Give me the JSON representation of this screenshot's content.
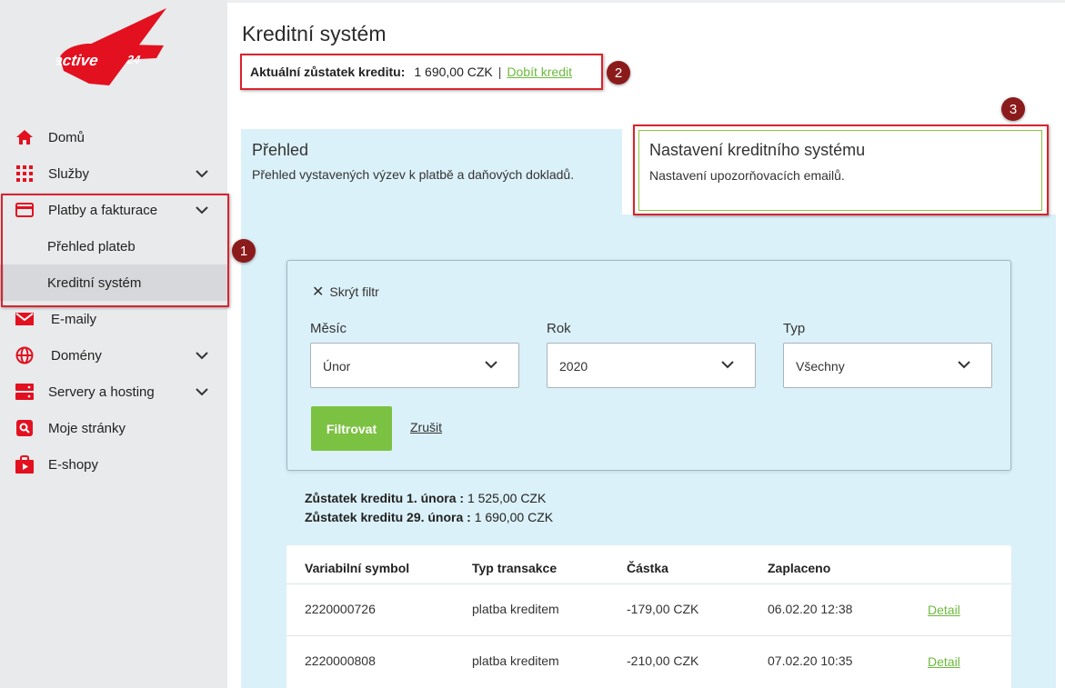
{
  "brand": {
    "logo_text": "active 24",
    "accent": "#e3101f"
  },
  "sidebar": {
    "items": [
      {
        "label": "Domů",
        "icon": "home-icon"
      },
      {
        "label": "Služby",
        "icon": "grid-icon"
      },
      {
        "label": "Platby a fakturace",
        "icon": "credit-card-icon"
      },
      {
        "label": "Přehled plateb"
      },
      {
        "label": "Kreditní systém"
      },
      {
        "label": "E-maily",
        "icon": "mail-icon"
      },
      {
        "label": "Domény",
        "icon": "globe-icon"
      },
      {
        "label": "Servery a hosting",
        "icon": "server-icon"
      },
      {
        "label": "Moje stránky",
        "icon": "search-page-icon"
      },
      {
        "label": "E-shopy",
        "icon": "shop-bag-icon"
      }
    ]
  },
  "annotations": [
    "1",
    "2",
    "3"
  ],
  "page": {
    "title": "Kreditní systém",
    "balance_label": "Aktuální zůstatek kreditu:",
    "balance_value": "1 690,00 CZK",
    "separator": "|",
    "topup_link": "Dobít kredit"
  },
  "tabs": [
    {
      "title": "Přehled",
      "desc": "Přehled vystavených výzev k platbě a daňových dokladů."
    },
    {
      "title": "Nastavení kreditního systému",
      "desc": "Nastavení upozorňovacích emailů."
    }
  ],
  "filter": {
    "hide_label": "Skrýt filtr",
    "month_label": "Měsíc",
    "month_value": "Únor",
    "year_label": "Rok",
    "year_value": "2020",
    "type_label": "Typ",
    "type_value": "Všechny",
    "submit_label": "Filtrovat",
    "cancel_label": "Zrušit"
  },
  "summary": {
    "start_label": "Zůstatek kreditu 1. února :",
    "start_value": "1 525,00 CZK",
    "end_label": "Zůstatek kreditu 29. února :",
    "end_value": "1 690,00 CZK"
  },
  "table": {
    "headers": [
      "Variabilní symbol",
      "Typ transakce",
      "Částka",
      "Zaplaceno"
    ],
    "rows": [
      {
        "symbol": "2220000726",
        "type": "platba kreditem",
        "amount": "-179,00 CZK",
        "paid": "06.02.20 12:38",
        "action": "Detail"
      },
      {
        "symbol": "2220000808",
        "type": "platba kreditem",
        "amount": "-210,00 CZK",
        "paid": "07.02.20 10:35",
        "action": "Detail"
      }
    ]
  },
  "colors": {
    "green": "#7cc242",
    "panel": "#dbf1f9",
    "annotation": "#d9232e"
  }
}
